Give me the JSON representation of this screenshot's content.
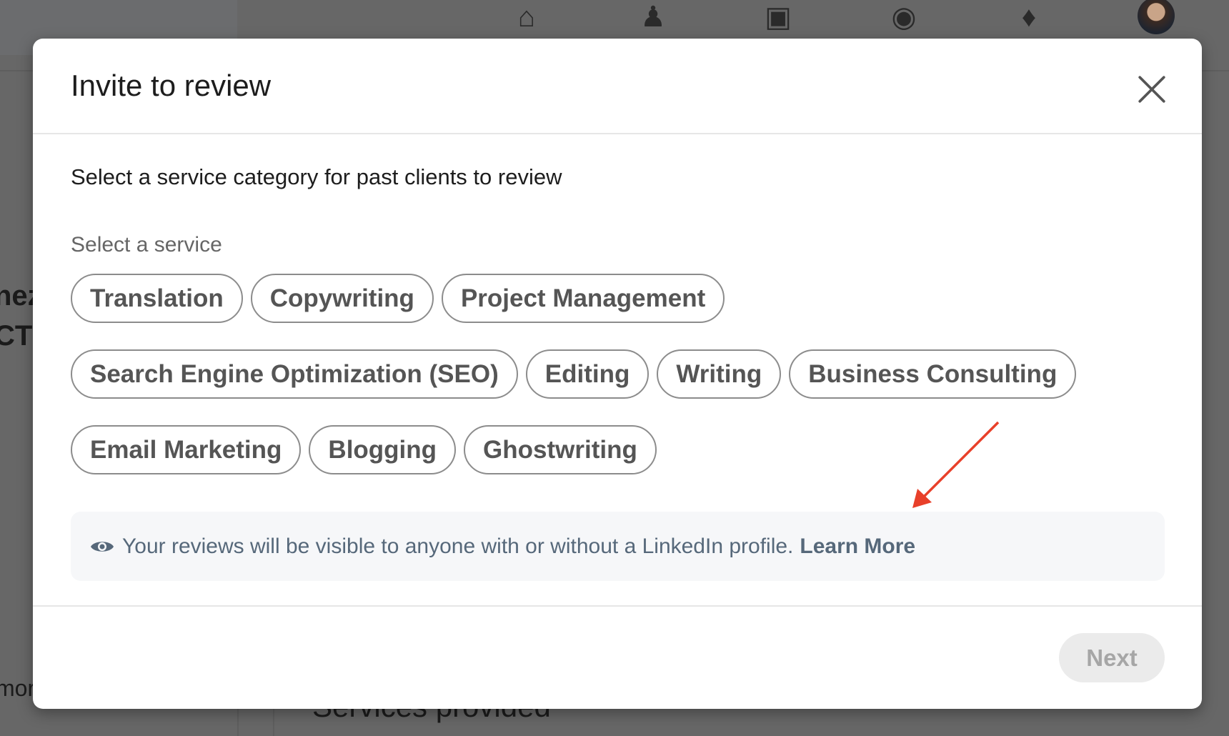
{
  "background": {
    "nav_icons": [
      "home-icon",
      "my-network-icon",
      "jobs-briefcase-icon",
      "messaging-icon",
      "notifications-bell-icon",
      "profile-avatar"
    ],
    "partial_text": [
      "nez",
      "CT",
      "mor",
      "Services provided"
    ]
  },
  "modal": {
    "title": "Invite to review",
    "close_label": "×",
    "subtitle": "Select a service category for past clients to review",
    "service_label": "Select a service",
    "services": [
      [
        "Translation",
        "Copywriting",
        "Project Management"
      ],
      [
        "Search Engine Optimization (SEO)",
        "Editing",
        "Writing",
        "Business Consulting"
      ],
      [
        "Email Marketing",
        "Blogging",
        "Ghostwriting"
      ]
    ],
    "info_text": "Your reviews will be visible to anyone with or without a LinkedIn profile.",
    "info_link": "Learn More",
    "next_label": "Next",
    "next_enabled": false
  },
  "annotation": {
    "type": "arrow",
    "color": "#e8402a"
  }
}
